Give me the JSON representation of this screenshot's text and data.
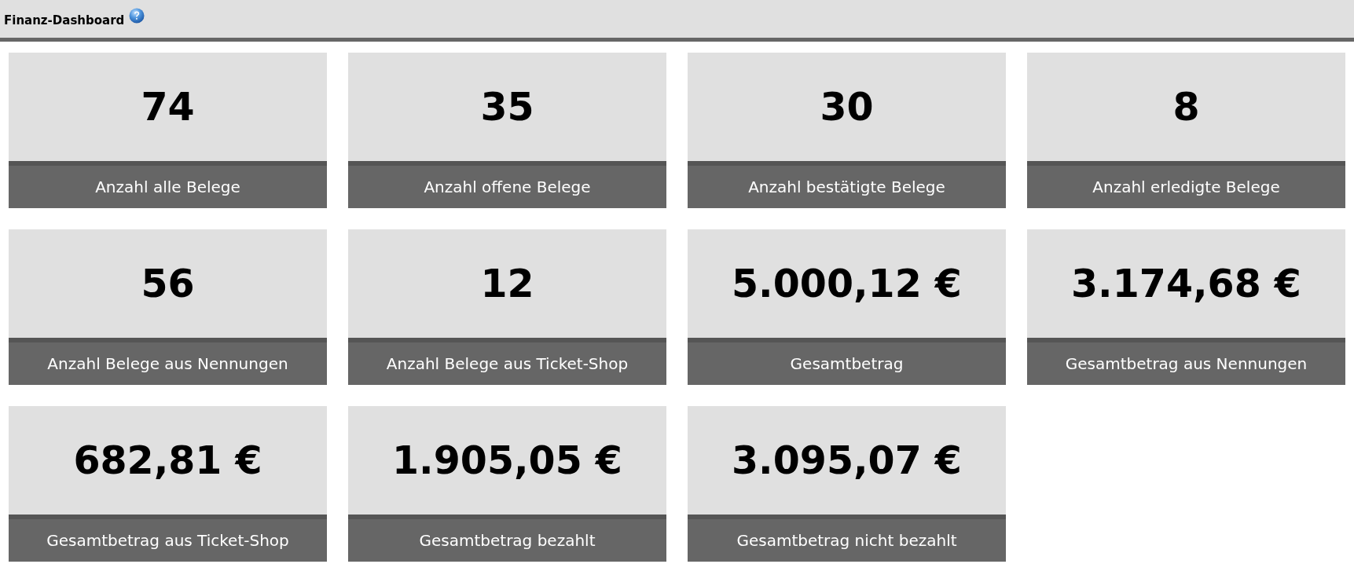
{
  "header": {
    "title": "Finanz-Dashboard"
  },
  "tiles": [
    {
      "value": "74",
      "label": "Anzahl alle Belege"
    },
    {
      "value": "35",
      "label": "Anzahl offene Belege"
    },
    {
      "value": "30",
      "label": "Anzahl bestätigte Belege"
    },
    {
      "value": "8",
      "label": "Anzahl erledigte Belege"
    },
    {
      "value": "56",
      "label": "Anzahl Belege aus Nennungen"
    },
    {
      "value": "12",
      "label": "Anzahl Belege aus Ticket-Shop"
    },
    {
      "value": "5.000,12 €",
      "label": "Gesamtbetrag"
    },
    {
      "value": "3.174,68 €",
      "label": "Gesamtbetrag aus Nennungen"
    },
    {
      "value": "682,81 €",
      "label": "Gesamtbetrag aus Ticket-Shop"
    },
    {
      "value": "1.905,05 €",
      "label": "Gesamtbetrag bezahlt"
    },
    {
      "value": "3.095,07 €",
      "label": "Gesamtbetrag nicht bezahlt"
    }
  ]
}
